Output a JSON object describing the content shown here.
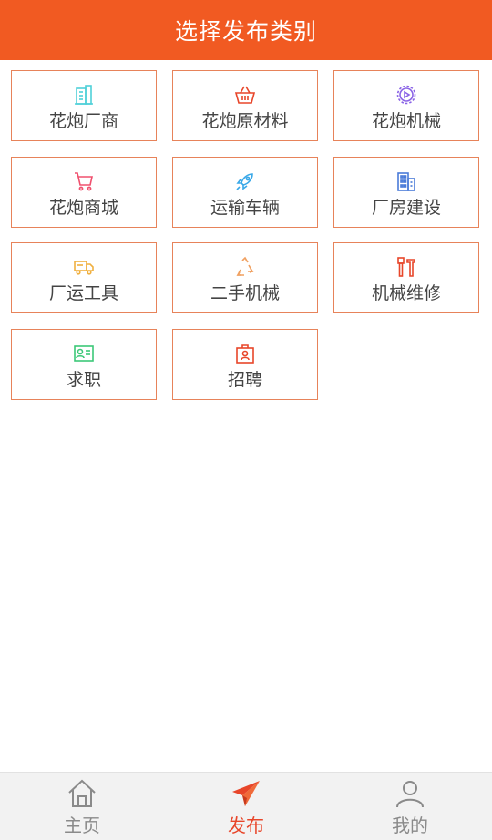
{
  "header": {
    "title": "选择发布类别"
  },
  "categories": [
    {
      "label": "花炮厂商",
      "icon": "building-icon",
      "color": "#4fd0d8"
    },
    {
      "label": "花炮原材料",
      "icon": "basket-icon",
      "color": "#e8462a"
    },
    {
      "label": "花炮机械",
      "icon": "gear-icon",
      "color": "#8a63e6"
    },
    {
      "label": "花炮商城",
      "icon": "cart-icon",
      "color": "#f0506e"
    },
    {
      "label": "运输车辆",
      "icon": "rocket-icon",
      "color": "#39a8e8"
    },
    {
      "label": "厂房建设",
      "icon": "office-building-icon",
      "color": "#4a7bd8"
    },
    {
      "label": "厂运工具",
      "icon": "truck-icon",
      "color": "#f0b040"
    },
    {
      "label": "二手机械",
      "icon": "recycle-icon",
      "color": "#f0a060"
    },
    {
      "label": "机械维修",
      "icon": "tools-icon",
      "color": "#e8462a"
    },
    {
      "label": "求职",
      "icon": "id-card-icon",
      "color": "#3cc878"
    },
    {
      "label": "招聘",
      "icon": "badge-icon",
      "color": "#e8462a"
    }
  ],
  "tabbar": {
    "tabs": [
      {
        "label": "主页",
        "icon": "home-icon",
        "active": false
      },
      {
        "label": "发布",
        "icon": "paper-plane-icon",
        "active": true
      },
      {
        "label": "我的",
        "icon": "user-icon",
        "active": false
      }
    ]
  },
  "colors": {
    "accent": "#f15a22",
    "tile_border": "#e7835a",
    "tab_active": "#e8462a",
    "tab_inactive": "#8a8a8a"
  }
}
